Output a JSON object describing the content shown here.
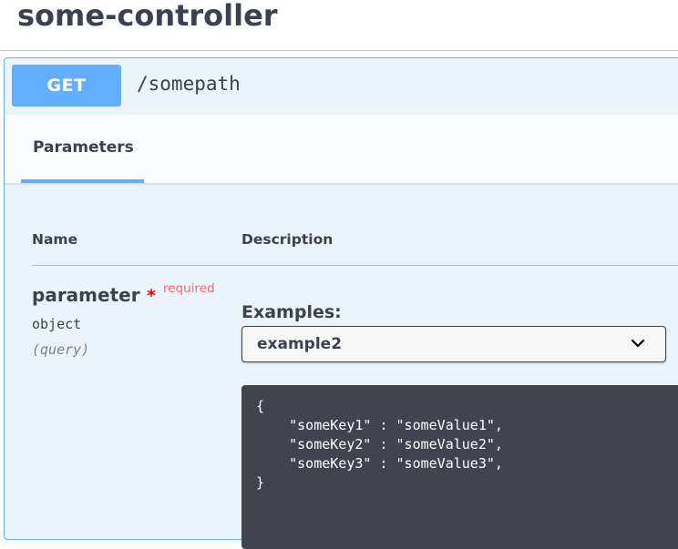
{
  "page": {
    "title": "some-controller"
  },
  "operation": {
    "method": "GET",
    "path": "/somepath"
  },
  "tabs": [
    {
      "label": "Parameters",
      "active": true
    }
  ],
  "table": {
    "headers": {
      "name": "Name",
      "description": "Description"
    }
  },
  "parameter": {
    "name": "parameter",
    "required_star": "*",
    "required_label": "required",
    "type": "object",
    "in": "(query)"
  },
  "examples": {
    "label": "Examples:",
    "selected": "example2",
    "code": "{\n    \"someKey1\" : \"someValue1\",\n    \"someKey2\" : \"someValue2\",\n    \"someKey3\" : \"someValue3\",\n}"
  },
  "colors": {
    "get_accent": "#61affe",
    "opblock_bg": "#ebf3fb",
    "code_bg": "#41444e",
    "required": "#ff6666"
  },
  "icons": {
    "select_toggle": "chevron-down-icon"
  }
}
